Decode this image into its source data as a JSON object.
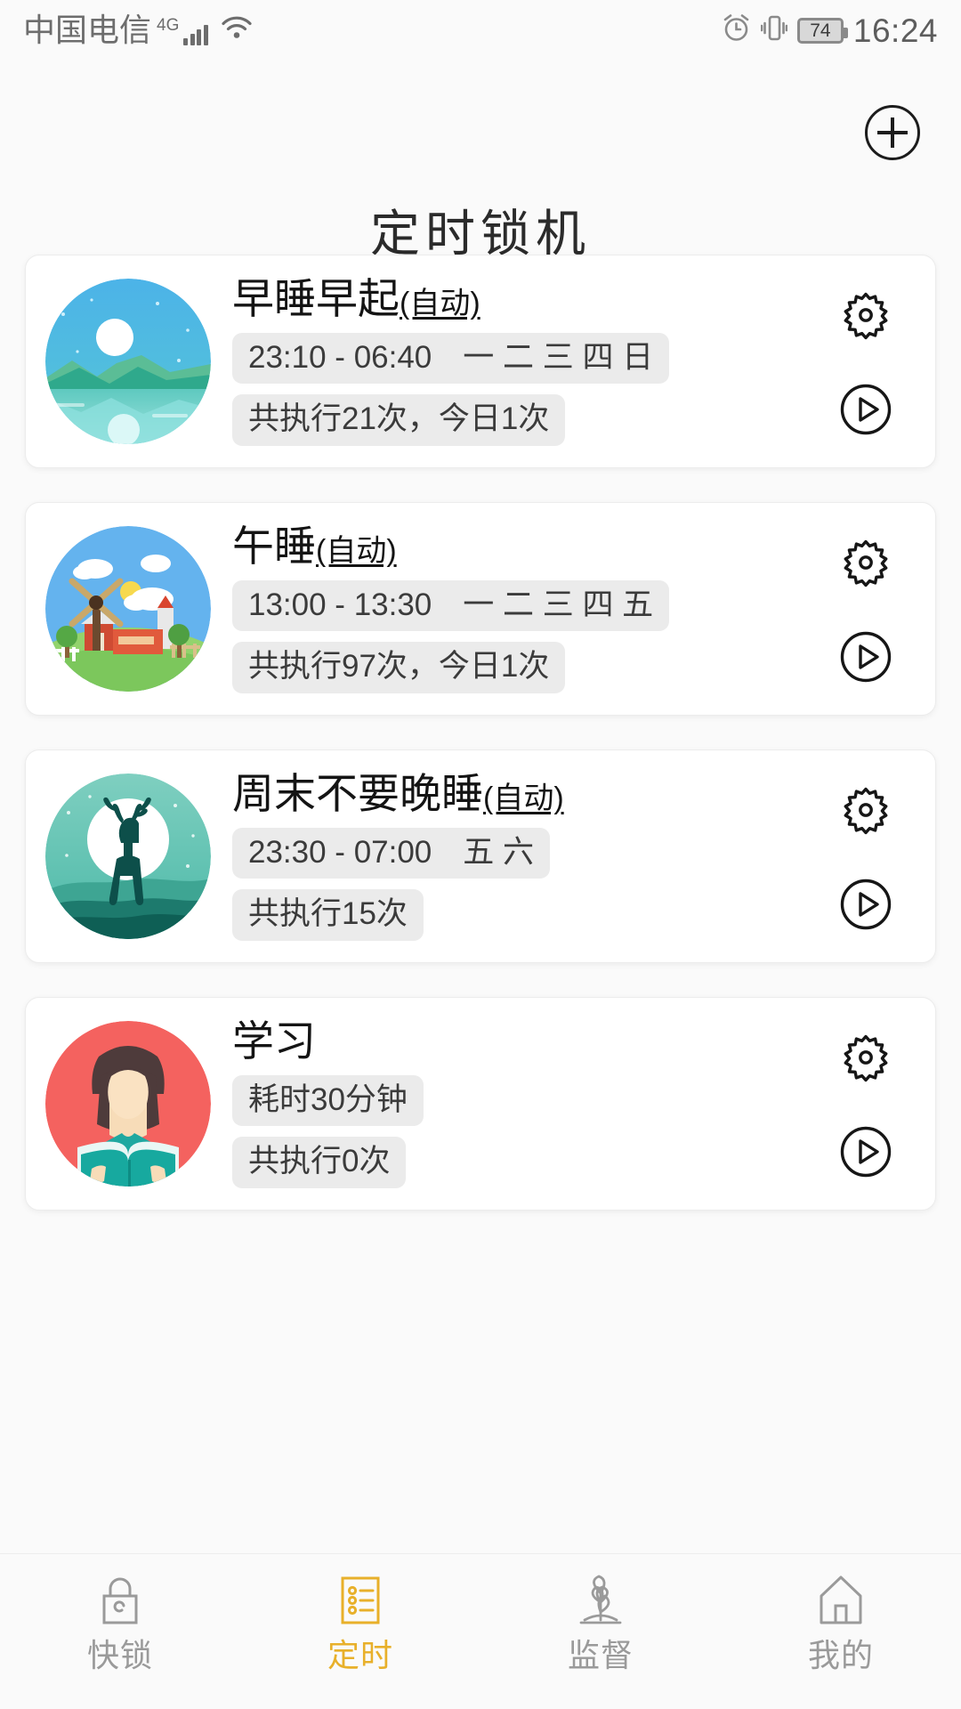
{
  "status_bar": {
    "carrier": "中国电信",
    "network": "4G",
    "signal_icon": "signal-bars-icon",
    "wifi_icon": "wifi-icon",
    "alarm_icon": "alarm-icon",
    "vibrate_icon": "vibrate-icon",
    "battery_level": "74",
    "time": "16:24"
  },
  "header": {
    "title": "定时锁机",
    "add_icon": "plus-circle-icon"
  },
  "tasks": [
    {
      "thumb": "moon-lake-landscape-image",
      "name": "早睡早起",
      "auto_label": "(自动)",
      "schedule": "23:10 - 06:40　一 二 三 四 日",
      "stats": "共执行21次，今日1次",
      "settings_icon": "gear-icon",
      "start_icon": "play-circle-icon"
    },
    {
      "thumb": "windmill-farm-image",
      "name": "午睡",
      "auto_label": "(自动)",
      "schedule": "13:00 - 13:30　一 二 三 四 五",
      "stats": "共执行97次，今日1次",
      "settings_icon": "gear-icon",
      "start_icon": "play-circle-icon"
    },
    {
      "thumb": "deer-moon-image",
      "name": "周末不要晚睡",
      "auto_label": "(自动)",
      "schedule": "23:30 - 07:00　五 六",
      "stats": "共执行15次",
      "settings_icon": "gear-icon",
      "start_icon": "play-circle-icon"
    },
    {
      "thumb": "girl-reading-book-image",
      "name": "学习",
      "auto_label": "",
      "schedule": "耗时30分钟",
      "stats": "共执行0次",
      "settings_icon": "gear-icon",
      "start_icon": "play-circle-icon"
    }
  ],
  "tabbar": {
    "active_index": 1,
    "active_color": "#e8b02a",
    "inactive_color": "#9a9a9a",
    "items": [
      {
        "label": "快锁",
        "icon": "lock-icon"
      },
      {
        "label": "定时",
        "icon": "checklist-icon"
      },
      {
        "label": "监督",
        "icon": "sprout-icon"
      },
      {
        "label": "我的",
        "icon": "house-icon"
      }
    ]
  }
}
